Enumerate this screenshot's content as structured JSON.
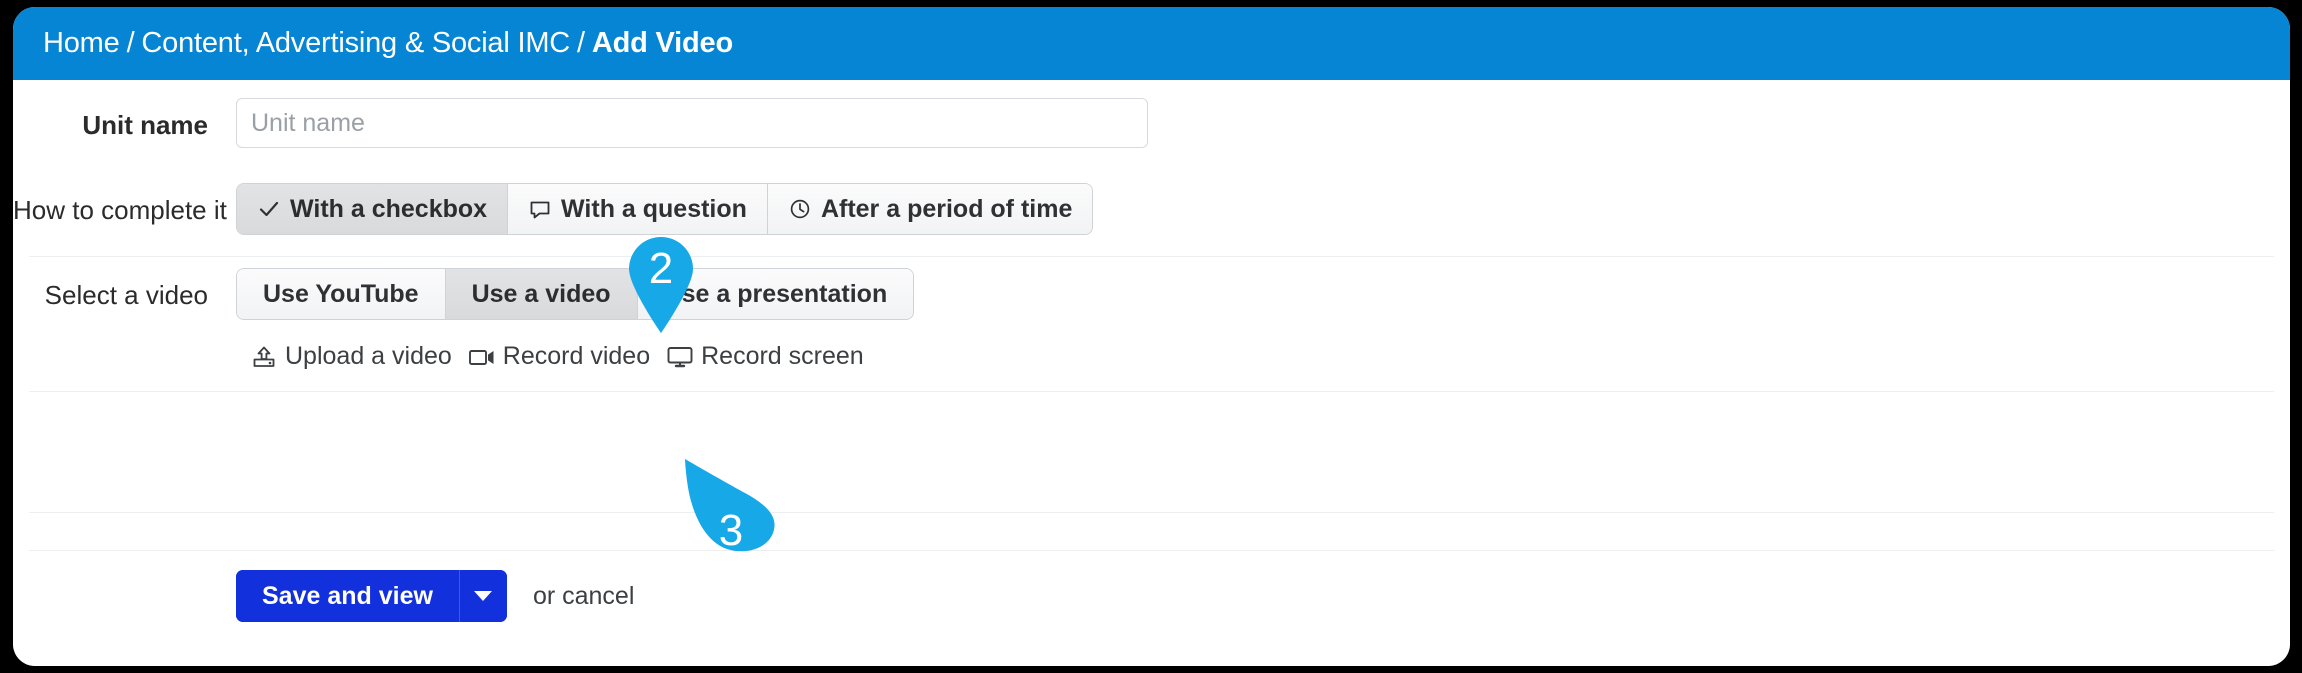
{
  "header": {
    "breadcrumb": [
      {
        "label": "Home",
        "current": false
      },
      {
        "label": "Content, Advertising & Social IMC",
        "current": false
      },
      {
        "label": "Add Video",
        "current": true
      }
    ],
    "separator": "/",
    "background_color": "#0585d4"
  },
  "form": {
    "unit_name": {
      "label": "Unit name",
      "placeholder": "Unit name",
      "value": ""
    },
    "how_to_complete": {
      "label": "How to complete it",
      "options": [
        {
          "label": "With a checkbox",
          "icon": "checkmark-icon",
          "active": true
        },
        {
          "label": "With a question",
          "icon": "speech-bubble-icon",
          "active": false
        },
        {
          "label": "After a period of time",
          "icon": "clock-icon",
          "active": false
        }
      ]
    },
    "select_a_video": {
      "label": "Select a video",
      "options": [
        {
          "label": "Use YouTube",
          "active": false
        },
        {
          "label": "Use a video",
          "active": true
        },
        {
          "label": "Use a presentation",
          "active": false
        }
      ],
      "media_actions": [
        {
          "label": "Upload a video",
          "icon": "upload-icon"
        },
        {
          "label": "Record video",
          "icon": "video-camera-icon"
        },
        {
          "label": "Record screen",
          "icon": "monitor-icon"
        }
      ]
    }
  },
  "footer": {
    "save_label": "Save and view",
    "save_dropdown_icon": "chevron-down-icon",
    "cancel_text": "or cancel",
    "save_color": "#1330dd"
  },
  "annotations": {
    "color": "#17a8e8",
    "pins": [
      {
        "number": "2",
        "target": "how-to-complete-button-group"
      },
      {
        "number": "3",
        "target": "record-video-link"
      }
    ]
  }
}
